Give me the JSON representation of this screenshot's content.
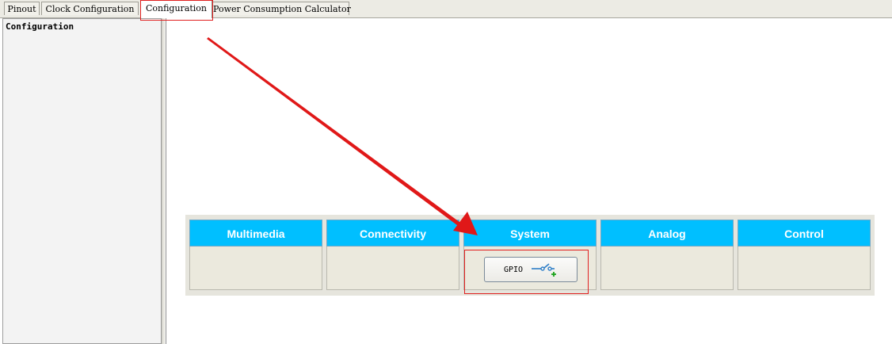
{
  "tabs": [
    {
      "label": "Pinout",
      "active": false
    },
    {
      "label": "Clock Configuration",
      "active": false
    },
    {
      "label": "Configuration",
      "active": true
    },
    {
      "label": "Power Consumption Calculator",
      "active": false
    }
  ],
  "left_panel": {
    "title": "Configuration"
  },
  "categories": [
    {
      "label": "Multimedia"
    },
    {
      "label": "Connectivity"
    },
    {
      "label": "System",
      "button": {
        "label": "GPIO",
        "icon": "gpio-switch-icon"
      }
    },
    {
      "label": "Analog"
    },
    {
      "label": "Control"
    }
  ],
  "colors": {
    "category_header": "#00bfff",
    "highlight": "#e02020"
  }
}
